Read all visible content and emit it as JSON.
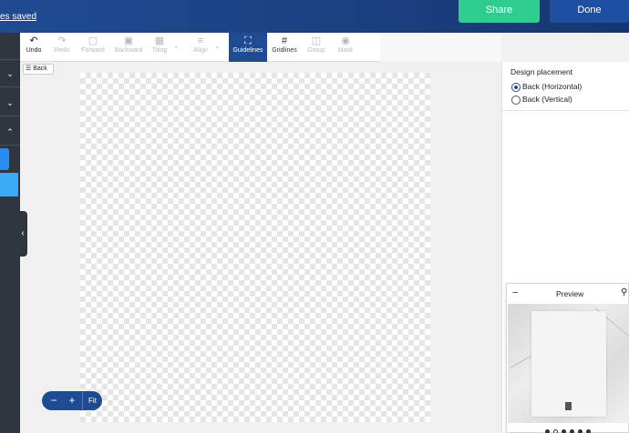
{
  "header": {
    "saved_text": "es saved",
    "share_label": "Share",
    "done_label": "Done"
  },
  "toolbar": {
    "undo": "Undo",
    "redo": "Redo",
    "forward": "Forward",
    "backward": "Backward",
    "tiling": "Tiling",
    "align": "Align",
    "guidelines": "Guidelines",
    "gridlines": "Gridlines",
    "group": "Group",
    "mask": "Mask"
  },
  "canvas": {
    "back_label": "Back"
  },
  "zoom": {
    "minus": "−",
    "plus": "+",
    "fit": "Fit"
  },
  "panel": {
    "heading": "Design placement",
    "options": [
      {
        "label": "Back (Horizontal)",
        "selected": true
      },
      {
        "label": "Back (Vertical)",
        "selected": false
      }
    ]
  },
  "preview": {
    "title": "Preview",
    "minimize": "−",
    "page_count": 6,
    "active_page": 2
  },
  "colors": {
    "brand": "#1f4b93",
    "share": "#2ecc8f",
    "rail": "#30363f"
  }
}
